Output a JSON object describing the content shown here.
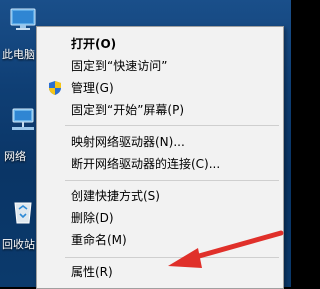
{
  "desktop": {
    "icons": [
      {
        "label": "此电脑"
      },
      {
        "label": "网络"
      },
      {
        "label": "回收站"
      }
    ]
  },
  "context_menu": {
    "items": [
      {
        "label": "打开(O)",
        "bold": true
      },
      {
        "label": "固定到“快速访问”"
      },
      {
        "label": "管理(G)",
        "icon": "admin-shield-icon"
      },
      {
        "label": "固定到“开始”屏幕(P)"
      },
      {
        "label": "映射网络驱动器(N)..."
      },
      {
        "label": "断开网络驱动器的连接(C)..."
      },
      {
        "label": "创建快捷方式(S)"
      },
      {
        "label": "删除(D)"
      },
      {
        "label": "重命名(M)"
      },
      {
        "label": "属性(R)"
      }
    ]
  },
  "annotation": {
    "icon": "red-arrow-icon",
    "color": "#e0302a"
  }
}
